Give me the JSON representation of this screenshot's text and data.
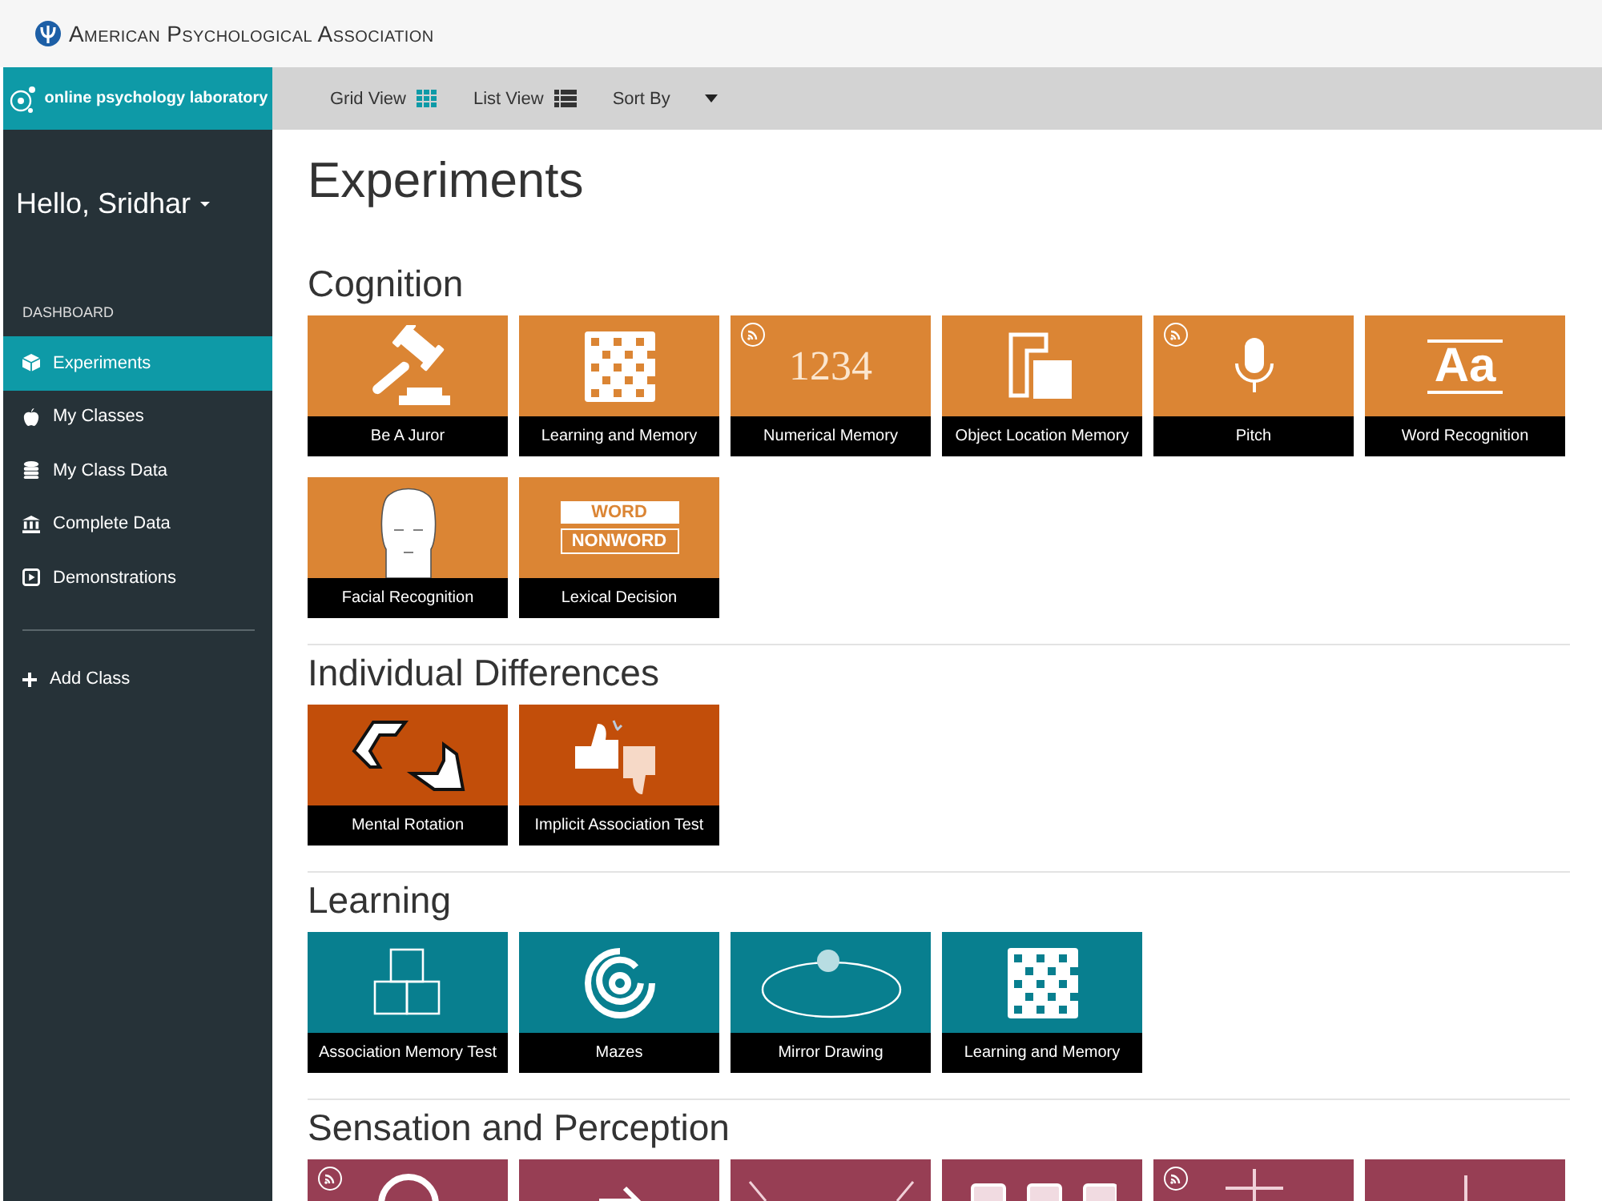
{
  "header": {
    "title": "American Psychological Association"
  },
  "sidebar": {
    "brand": "online psychology laboratory",
    "greeting": "Hello, Sridhar",
    "section_label": "DASHBOARD",
    "items": [
      {
        "label": "Experiments",
        "kind": "cube",
        "selected": true
      },
      {
        "label": "My Classes",
        "kind": "apple",
        "selected": false
      },
      {
        "label": "My Class Data",
        "kind": "database",
        "selected": false
      },
      {
        "label": "Complete Data",
        "kind": "bank",
        "selected": false
      },
      {
        "label": "Demonstrations",
        "kind": "play",
        "selected": false
      }
    ],
    "add_item": {
      "label": "Add Class"
    }
  },
  "toolbar": {
    "grid_view": "Grid View",
    "list_view": "List View",
    "sort_by": "Sort By"
  },
  "page_title": "Experiments",
  "sections": [
    {
      "title": "Cognition",
      "color": "#db8534",
      "tiles": [
        {
          "label": "Be A Juror",
          "kind": "gavel",
          "badge": false
        },
        {
          "label": "Learning and Memory",
          "kind": "grid",
          "badge": false
        },
        {
          "label": "Numerical Memory",
          "kind": "digits",
          "art_text": "1234",
          "badge": true
        },
        {
          "label": "Object Location Memory",
          "kind": "location",
          "badge": false
        },
        {
          "label": "Pitch",
          "kind": "mic",
          "badge": true
        },
        {
          "label": "Word Recognition",
          "kind": "letters",
          "art_text": "Aa",
          "badge": false
        },
        {
          "label": "Facial Recognition",
          "kind": "face",
          "badge": false
        },
        {
          "label": "Lexical Decision",
          "kind": "words",
          "art_text": "WORD",
          "art_text_2": "NONWORD",
          "badge": false
        }
      ]
    },
    {
      "title": "Individual Differences",
      "color": "#c24e0a",
      "tiles": [
        {
          "label": "Mental Rotation",
          "kind": "rotation",
          "badge": false
        },
        {
          "label": "Implicit Association Test",
          "kind": "thumbs",
          "badge": false
        }
      ]
    },
    {
      "title": "Learning",
      "color": "#087f8f",
      "tiles": [
        {
          "label": "Association Memory Test",
          "kind": "blocks",
          "badge": false
        },
        {
          "label": "Mazes",
          "kind": "maze",
          "badge": false
        },
        {
          "label": "Mirror Drawing",
          "kind": "ellipse",
          "badge": false
        },
        {
          "label": "Learning and Memory",
          "kind": "grid",
          "badge": false
        }
      ]
    },
    {
      "title": "Sensation and Perception",
      "color": "#973e54",
      "tiles": [
        {
          "kind": "ring",
          "badge": true
        },
        {
          "kind": "arrow",
          "badge": false
        },
        {
          "kind": "lines",
          "badge": false
        },
        {
          "kind": "panels",
          "badge": false
        },
        {
          "kind": "cross",
          "badge": true
        },
        {
          "kind": "bar",
          "badge": false
        }
      ]
    }
  ]
}
